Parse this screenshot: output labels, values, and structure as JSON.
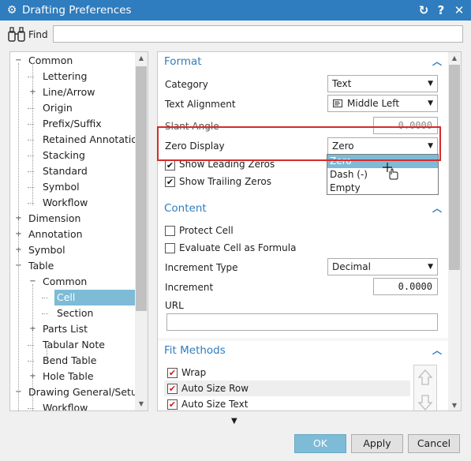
{
  "window": {
    "title": "Drafting Preferences",
    "titlebar_color": "#2f7cbe",
    "reset_icon": "reset-icon",
    "help_icon": "help-icon",
    "close_icon": "close-icon"
  },
  "find": {
    "label": "Find",
    "value": "",
    "icon": "binoculars-icon"
  },
  "tree": {
    "items": [
      {
        "label": "Common",
        "level": 0,
        "expander": "minus"
      },
      {
        "label": "Lettering",
        "level": 1,
        "expander": ""
      },
      {
        "label": "Line/Arrow",
        "level": 1,
        "expander": "plus"
      },
      {
        "label": "Origin",
        "level": 1,
        "expander": ""
      },
      {
        "label": "Prefix/Suffix",
        "level": 1,
        "expander": ""
      },
      {
        "label": "Retained Annotation",
        "level": 1,
        "expander": ""
      },
      {
        "label": "Stacking",
        "level": 1,
        "expander": ""
      },
      {
        "label": "Standard",
        "level": 1,
        "expander": ""
      },
      {
        "label": "Symbol",
        "level": 1,
        "expander": ""
      },
      {
        "label": "Workflow",
        "level": 1,
        "expander": ""
      },
      {
        "label": "Dimension",
        "level": 0,
        "expander": "plus"
      },
      {
        "label": "Annotation",
        "level": 0,
        "expander": "plus"
      },
      {
        "label": "Symbol",
        "level": 0,
        "expander": "plus"
      },
      {
        "label": "Table",
        "level": 0,
        "expander": "minus"
      },
      {
        "label": "Common",
        "level": 1,
        "expander": "minus"
      },
      {
        "label": "Cell",
        "level": 2,
        "expander": "",
        "selected": true
      },
      {
        "label": "Section",
        "level": 2,
        "expander": ""
      },
      {
        "label": "Parts List",
        "level": 1,
        "expander": "plus"
      },
      {
        "label": "Tabular Note",
        "level": 1,
        "expander": ""
      },
      {
        "label": "Bend Table",
        "level": 1,
        "expander": ""
      },
      {
        "label": "Hole Table",
        "level": 1,
        "expander": "plus"
      },
      {
        "label": "Drawing General/Setup",
        "level": 0,
        "expander": "minus"
      },
      {
        "label": "Workflow",
        "level": 1,
        "expander": ""
      }
    ]
  },
  "format": {
    "title": "Format",
    "category_label": "Category",
    "category_value": "Text",
    "alignment_label": "Text Alignment",
    "alignment_value": "Middle Left",
    "slant_label": "Slant Angle",
    "slant_value": "0.0000",
    "zero_display_label": "Zero Display",
    "zero_display_value": "Zero",
    "show_leading_zeros": "Show Leading Zeros",
    "show_trailing_zeros": "Show Trailing Zeros",
    "zero_options": [
      "Zero",
      "Dash (-)",
      "Empty"
    ]
  },
  "content": {
    "title": "Content",
    "protect_cell": "Protect Cell",
    "evaluate_formula": "Evaluate Cell as Formula",
    "increment_type_label": "Increment  Type",
    "increment_type_value": "Decimal",
    "increment_label": "Increment",
    "increment_value": "0.0000",
    "url_label": "URL",
    "url_value": ""
  },
  "fit_methods": {
    "title": "Fit Methods",
    "items": [
      "Wrap",
      "Auto Size Row",
      "Auto Size Text"
    ]
  },
  "buttons": {
    "ok": "OK",
    "apply": "Apply",
    "cancel": "Cancel"
  },
  "colors": {
    "accent": "#2f7cbe",
    "selection": "#7dbbd7",
    "highlight": "#d52b2b"
  }
}
